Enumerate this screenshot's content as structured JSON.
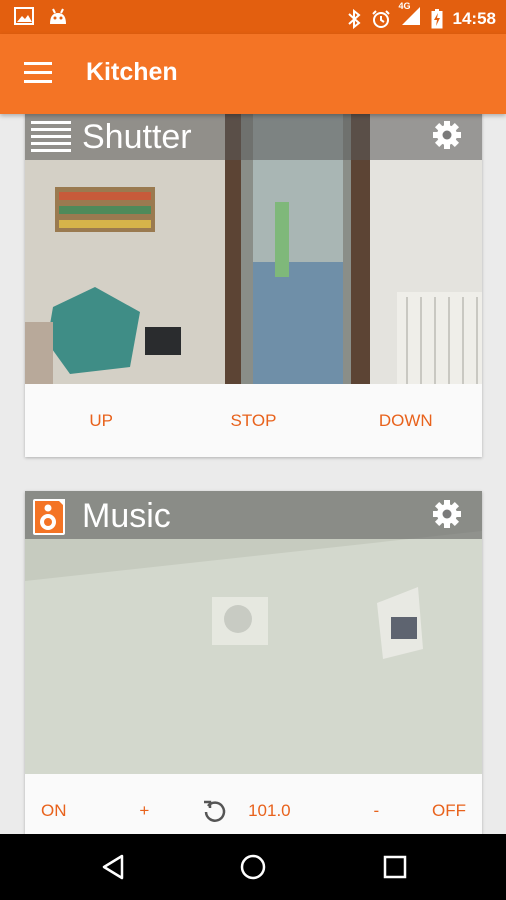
{
  "status_bar": {
    "time": "14:58",
    "network": "4G",
    "icons": [
      "image-icon",
      "android-icon",
      "bluetooth-icon",
      "alarm-icon",
      "signal-icon",
      "battery-charging-icon"
    ]
  },
  "app_bar": {
    "title": "Kitchen",
    "menu_icon": "hamburger-menu-icon"
  },
  "cards": [
    {
      "title": "Shutter",
      "type_icon": "shutter-icon",
      "settings_icon": "gear-icon",
      "actions": [
        "UP",
        "STOP",
        "DOWN"
      ]
    },
    {
      "title": "Music",
      "type_icon": "speaker-icon",
      "settings_icon": "gear-icon",
      "controls": {
        "on_label": "ON",
        "plus_label": "+",
        "refresh_icon": "refresh-icon",
        "value": "101.0",
        "minus_label": "-",
        "off_label": "OFF"
      }
    }
  ],
  "nav_bar": {
    "icons": [
      "back-icon",
      "home-icon",
      "recents-icon"
    ]
  },
  "colors": {
    "status_bar": "#e35f0f",
    "app_bar": "#f47425",
    "accent_text": "#e8621c"
  }
}
